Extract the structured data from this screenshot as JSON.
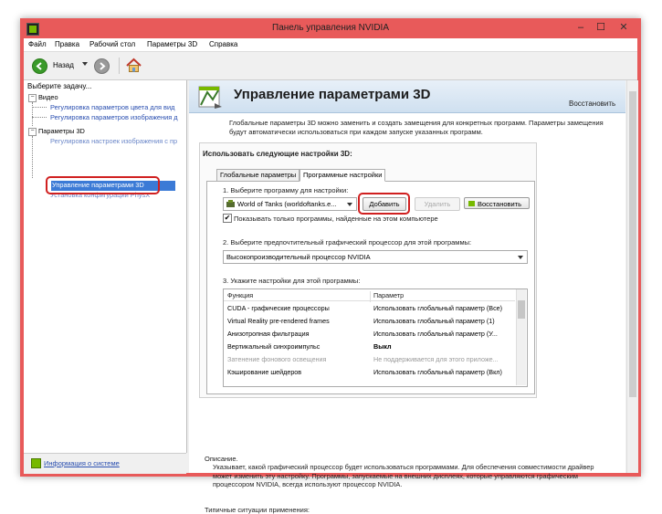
{
  "window": {
    "title": "Панель управления NVIDIA",
    "minimize": "‒",
    "maximize": "☐",
    "close": "✕"
  },
  "menu": [
    "Файл",
    "Правка",
    "Рабочий стол",
    "Параметры 3D",
    "Справка"
  ],
  "toolbar": {
    "back_label": "Назад"
  },
  "left_pane": {
    "heading": "Выберите задачу...",
    "tree": {
      "video": "Видео",
      "video_items": [
        "Регулировка параметров цвета для вид",
        "Регулировка параметров изображения д"
      ],
      "params3d": "Параметры 3D",
      "params3d_items": [
        "Регулировка настроек изображения с пр",
        "Управление параметрами 3D",
        "Установка конфигурации PhysX"
      ]
    },
    "system_info_link": "Информация о системе"
  },
  "right_pane": {
    "title": "Управление параметрами 3D",
    "restore_link": "Восстановить",
    "intro": "Глобальные параметры 3D можно заменить и создать замещения для конкретных программ. Параметры замещения будут автоматически использоваться при каждом запуске указанных программ.",
    "group_title": "Использовать следующие настройки 3D:",
    "tabs": [
      "Глобальные параметры",
      "Программные настройки"
    ],
    "active_tab": 1,
    "step1": "1. Выберите программу для настройки:",
    "program_value": "World of Tanks (worldoftanks.e...",
    "btn_add": "Добавить",
    "btn_remove": "Удалить",
    "btn_restore": "Восстановить",
    "show_only_label": "Показывать только программы, найденные на этом компьютере",
    "show_only_checked": true,
    "step2": "2. Выберите предпочтительный графический процессор для этой программы:",
    "gpu_value": "Высокопроизводительный процессор NVIDIA",
    "step3": "3. Укажите настройки для этой программы:",
    "grid_headers": [
      "Функция",
      "Параметр"
    ],
    "grid_rows": [
      {
        "func": "CUDA - графические процессоры",
        "param": "Использовать глобальный параметр (Все)",
        "dim": false,
        "bold": false
      },
      {
        "func": "Virtual Reality pre-rendered frames",
        "param": "Использовать глобальный параметр (1)",
        "dim": false,
        "bold": false
      },
      {
        "func": "Анизотропная фильтрация",
        "param": "Использовать глобальный параметр (У...",
        "dim": false,
        "bold": false
      },
      {
        "func": "Вертикальный синхроимпульс",
        "param": "Выкл",
        "dim": false,
        "bold": true
      },
      {
        "func": "Затенение фонового освещения",
        "param": "Не поддерживается для этого приложе...",
        "dim": true,
        "bold": false
      },
      {
        "func": "Кэширование шейдеров",
        "param": "Использовать глобальный параметр (Вкл)",
        "dim": false,
        "bold": false
      }
    ],
    "desc_label": "Описание.",
    "desc_text": "Указывает, какой графический процессор будет использоваться программами. Для обеспечения совместимости драйвер может изменить эту настройку. Программы, запускаемые на внешних дисплеях, которые управляются графическим процессором NVIDIA, всегда используют процессор NVIDIA.",
    "cut_line": "Типичные ситуации применения:"
  },
  "colors": {
    "title_bar": "#e85a5a",
    "selection": "#3b7ad6",
    "highlight_box": "#d02020",
    "nvidia_green": "#76b900"
  }
}
